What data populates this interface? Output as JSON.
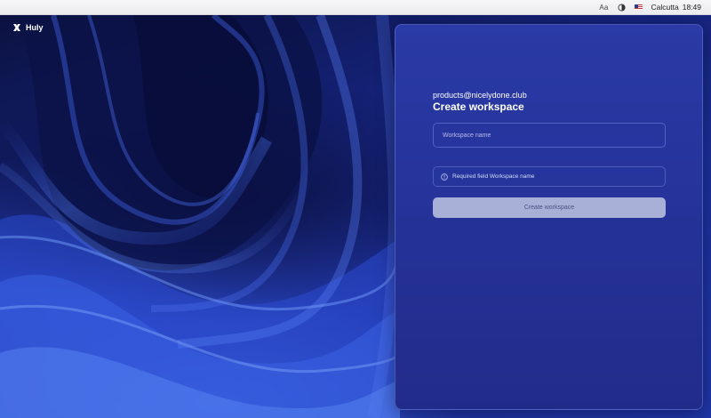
{
  "system_bar": {
    "font_button": "Aa",
    "theme_icon": "contrast-icon",
    "language_icon": "us-flag-icon",
    "location": "Calcutta",
    "time": "18:49"
  },
  "app": {
    "logo_icon": "huly-logo-icon",
    "name": "Huly"
  },
  "form": {
    "email": "products@nicelydone.club",
    "title": "Create workspace",
    "workspace_input": {
      "value": "",
      "placeholder": "Workspace name"
    },
    "notice_icon": "info-icon",
    "notice_text": "Required field Workspace name",
    "submit_label": "Create workspace"
  },
  "colors": {
    "panel": "#2a3aa6",
    "button_disabled": "#a9b0d8",
    "button_text": "#4a5180"
  }
}
